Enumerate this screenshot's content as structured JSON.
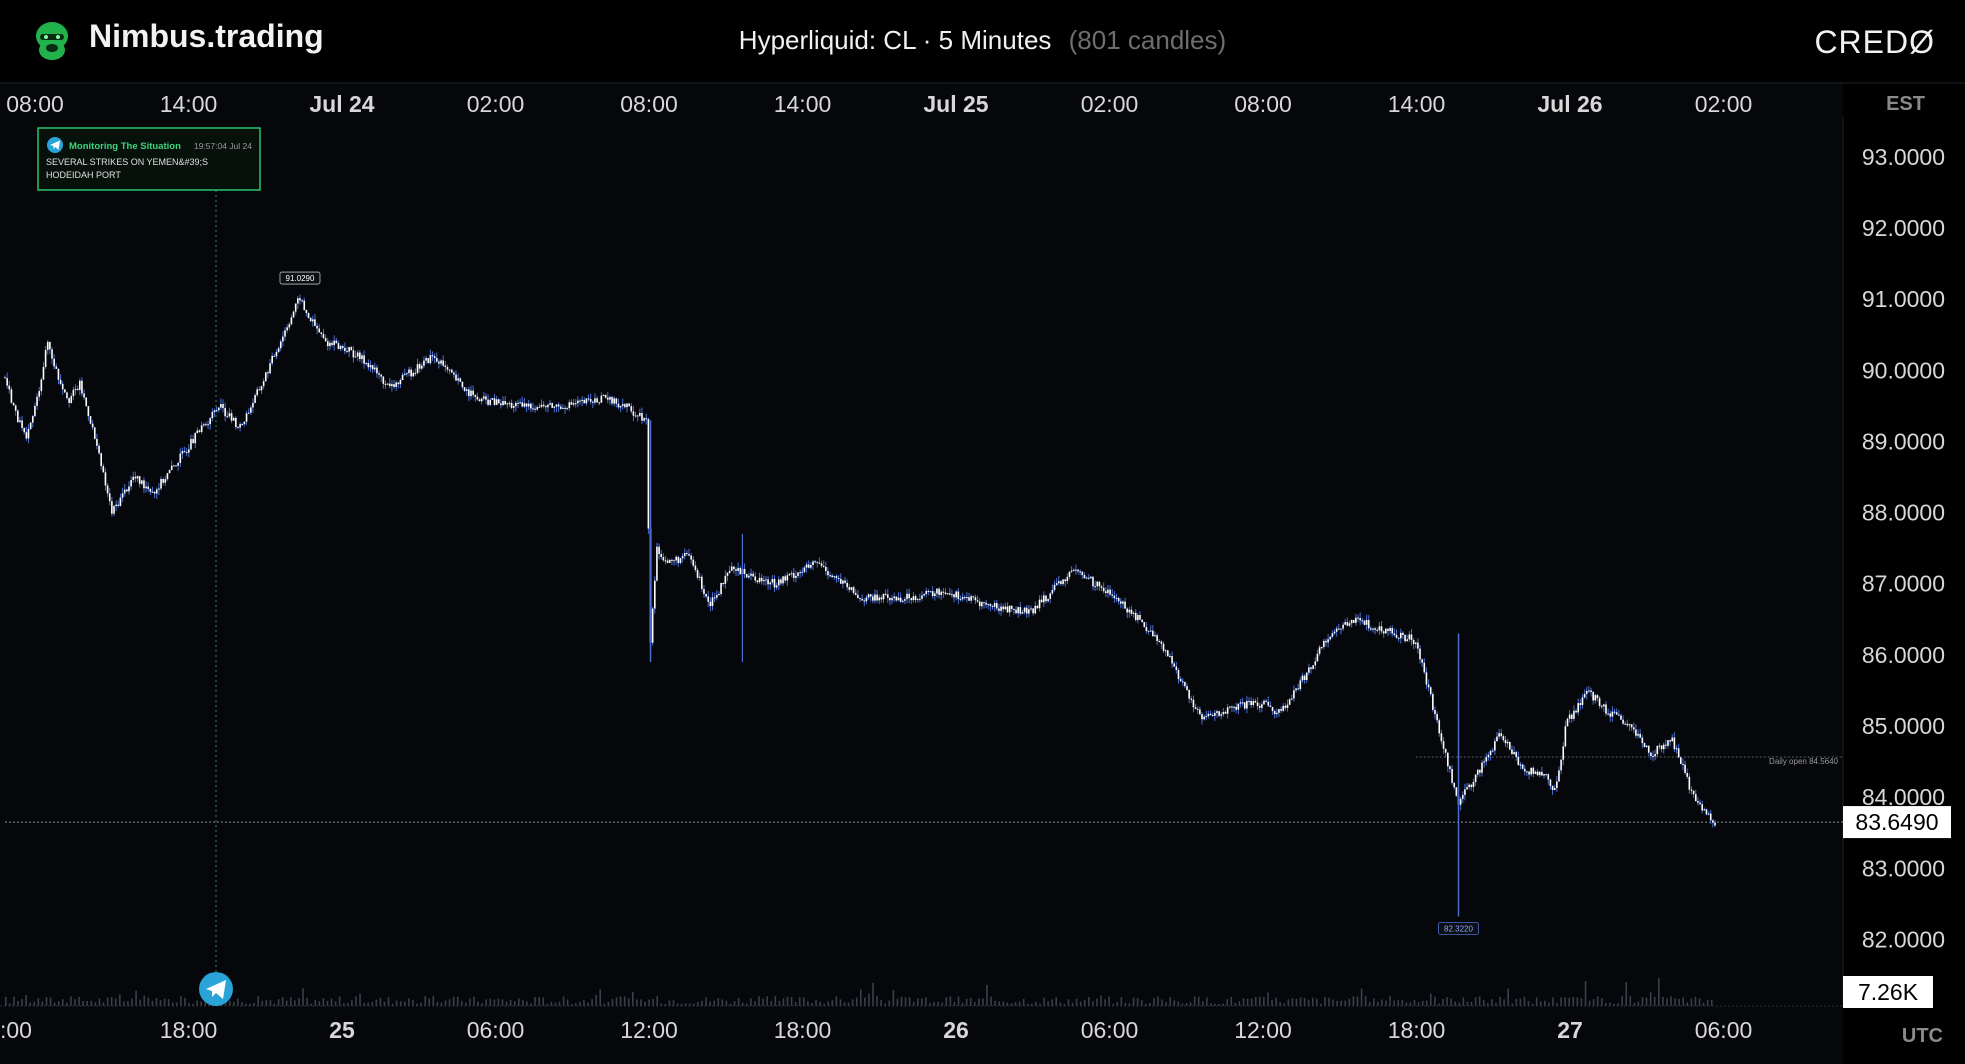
{
  "header": {
    "brand": "Nimbus.trading",
    "title": "Hyperliquid: CL · 5 Minutes",
    "candles": "(801 candles)",
    "partner": "CREDØ",
    "logo_icon": "gorilla-logo-icon"
  },
  "colors": {
    "background": "#05070b",
    "candle": "#ffffff",
    "wick": "#4a6fd0",
    "annotation_border": "#29c46a",
    "telegram": "#2aa3d9"
  },
  "annotation": {
    "source": "Monitoring The Situation",
    "time": "19:57:04 Jul 24",
    "text_line1": "SEVERAL STRIKES ON YEMEN&#39;S",
    "text_line2": "HODEIDAH PORT",
    "icon": "telegram-icon"
  },
  "chart_data": {
    "type": "candlestick",
    "title": "Hyperliquid: CL · 5 Minutes",
    "top_axis_timezone": "EST",
    "bottom_axis_timezone": "UTC",
    "top_axis_ticks": [
      "08:00",
      "14:00",
      "Jul 24",
      "02:00",
      "08:00",
      "14:00",
      "Jul 25",
      "02:00",
      "08:00",
      "14:00",
      "Jul 26",
      "02:00"
    ],
    "bottom_axis_ticks": [
      ":00",
      "18:00",
      "25",
      "06:00",
      "12:00",
      "18:00",
      "26",
      "06:00",
      "12:00",
      "18:00",
      "27",
      "06:00"
    ],
    "y_ticks": [
      "93.0000",
      "92.0000",
      "91.0000",
      "90.0000",
      "89.0000",
      "88.0000",
      "87.0000",
      "86.0000",
      "85.0000",
      "84.0000",
      "83.0000",
      "82.0000"
    ],
    "ylim": [
      81.12,
      93.56
    ],
    "x": [
      0,
      0.5,
      1,
      1.5,
      2,
      2.5,
      3,
      3.5,
      4,
      5,
      6,
      7,
      8,
      9,
      10,
      11,
      12,
      13,
      13.8,
      14,
      15,
      16,
      17,
      18,
      20,
      22,
      24,
      26,
      28,
      29,
      30,
      30.2,
      30.5,
      31,
      32,
      33,
      34,
      36,
      38,
      40,
      42,
      44,
      46,
      48,
      50,
      52,
      54,
      56,
      58,
      59,
      59.5,
      60,
      62,
      63,
      64,
      66,
      68,
      70,
      71,
      72,
      72.5,
      72.8,
      73,
      74,
      75,
      76,
      77,
      78,
      79,
      80
    ],
    "values": [
      89.9,
      89.4,
      89.0,
      89.6,
      90.4,
      89.9,
      89.6,
      89.8,
      89.3,
      88.0,
      88.5,
      88.3,
      88.7,
      89.1,
      89.5,
      89.2,
      89.8,
      90.5,
      91.03,
      90.85,
      90.4,
      90.3,
      90.1,
      89.75,
      90.2,
      89.6,
      89.5,
      89.5,
      89.6,
      89.5,
      89.3,
      86.2,
      87.5,
      87.3,
      87.4,
      86.7,
      87.2,
      87.0,
      87.3,
      86.8,
      86.8,
      86.9,
      86.7,
      86.6,
      87.2,
      86.8,
      86.2,
      85.1,
      85.3,
      85.3,
      85.2,
      85.3,
      86.3,
      86.5,
      86.4,
      86.2,
      83.9,
      84.9,
      84.4,
      84.3,
      84.1,
      84.5,
      85.0,
      85.5,
      85.2,
      85.0,
      84.6,
      84.8,
      84.0,
      83.649
    ],
    "x_unit": "hours since first candle (EST Jul 23 08:00)",
    "last_price": "83.6490",
    "last_price_value": 83.649,
    "daily_open_label": "Daily open 84.5640",
    "daily_open_value": 84.564,
    "high_label": "91.0290",
    "high_value": 91.029,
    "low_label": "82.3220",
    "low_value": 82.322,
    "volume_last": "7.26K"
  }
}
